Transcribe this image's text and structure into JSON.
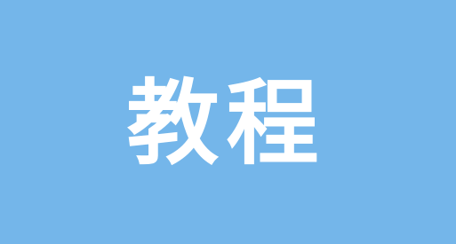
{
  "banner": {
    "title": "教程",
    "background_color": "#74b6ea",
    "text_color": "#ffffff"
  }
}
